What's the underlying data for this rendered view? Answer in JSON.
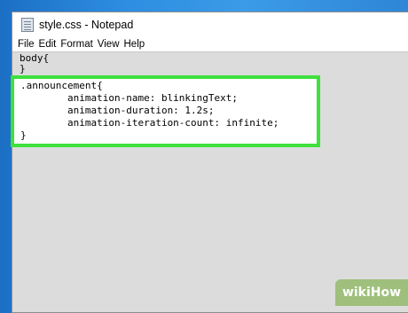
{
  "window": {
    "title": "style.css - Notepad"
  },
  "menu": [
    "File",
    "Edit",
    "Format",
    "View",
    "Help"
  ],
  "editor": {
    "lines_before": [
      "body{",
      "}"
    ],
    "highlighted_lines": [
      ".announcement{",
      "        animation-name: blinkingText;",
      "        animation-duration: 1.2s;",
      "        animation-iteration-count: infinite;",
      "}"
    ]
  },
  "watermark": "wikiHow",
  "colors": {
    "highlight_border": "#3ee03e",
    "desktop": "#2d8de0"
  }
}
